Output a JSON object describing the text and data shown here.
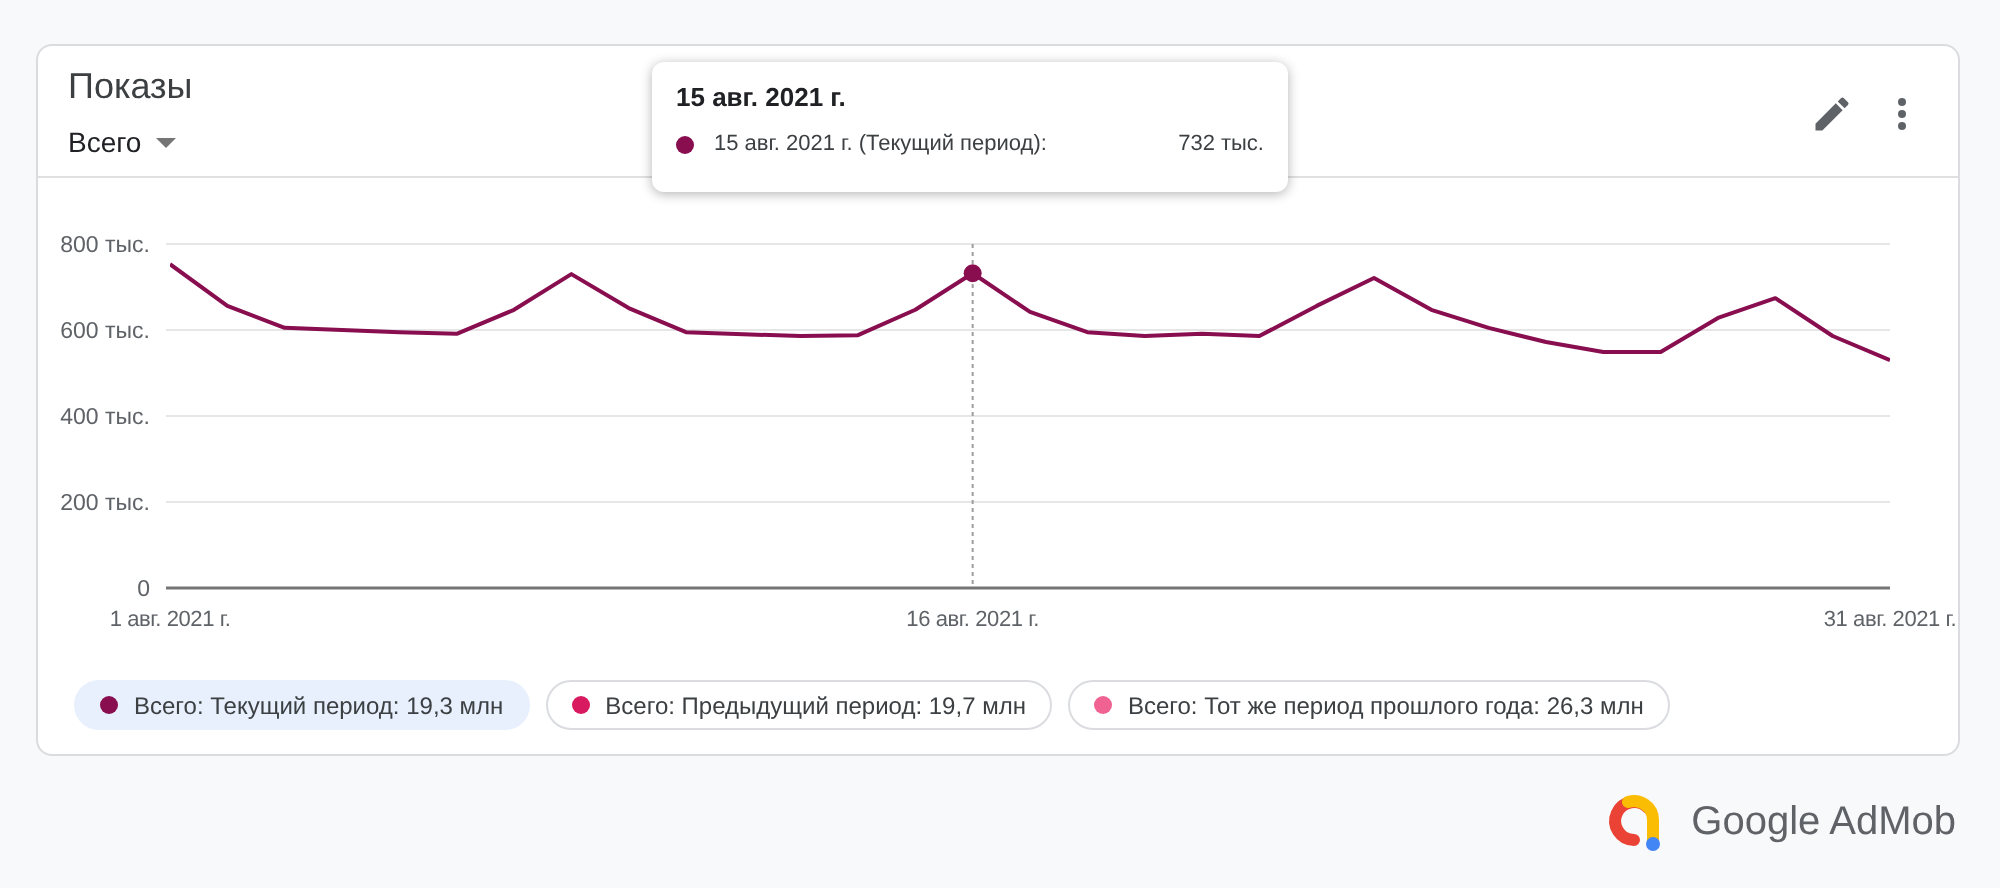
{
  "card": {
    "title": "Показы",
    "dropdown": {
      "label": "Всего"
    },
    "tooltip": {
      "title": "15 авг. 2021 г.",
      "label": "15 авг. 2021 г. (Текущий период):",
      "value": "732 тыс.",
      "color": "#880e4f"
    },
    "chart_data": {
      "type": "line",
      "categories": [
        "1 авг. 2021 г.",
        null,
        null,
        null,
        null,
        null,
        null,
        null,
        null,
        null,
        null,
        null,
        null,
        null,
        "16 авг. 2021 г.",
        null,
        null,
        null,
        null,
        null,
        null,
        null,
        null,
        null,
        null,
        null,
        null,
        null,
        null,
        null,
        "31 авг. 2021 г."
      ],
      "series": [
        {
          "color": "#880e4f",
          "values": [
            753,
            656,
            605,
            600,
            595,
            591,
            647,
            730,
            651,
            595,
            590,
            586,
            588,
            647,
            732,
            642,
            595,
            586,
            591,
            586,
            656,
            721,
            647,
            605,
            572,
            549,
            549,
            628,
            674,
            586,
            530
          ]
        }
      ],
      "ylim": [
        0,
        800
      ],
      "yticks": [
        0,
        {
          "value": 200,
          "label": "200 тыс."
        },
        {
          "value": 400,
          "label": "400 тыс."
        },
        {
          "value": 600,
          "label": "600 тыс."
        },
        {
          "value": 800,
          "label": "800 тыс."
        }
      ],
      "grid": true,
      "annotations": [
        {
          "x": "16 авг. 2021 г."
        }
      ]
    },
    "legend": [
      {
        "label": "Всего: Текущий период: 19,3 млн",
        "color": "#880e4f",
        "selected": true
      },
      {
        "label": "Всего: Предыдущий период: 19,7 млн",
        "color": "#d81b60",
        "selected": false
      },
      {
        "label": "Всего: Тот же период прошлого года: 26,3 млн",
        "color": "#f06292",
        "selected": false
      }
    ]
  },
  "logo": {
    "text": "Google AdMob"
  }
}
